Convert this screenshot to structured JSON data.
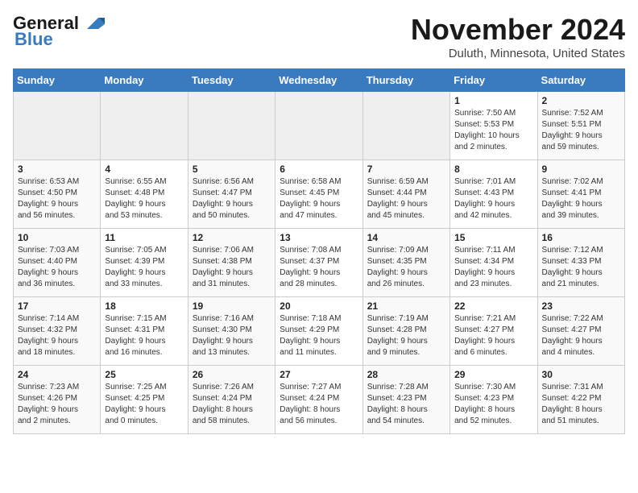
{
  "header": {
    "logo_general": "General",
    "logo_blue": "Blue",
    "month": "November 2024",
    "location": "Duluth, Minnesota, United States"
  },
  "weekdays": [
    "Sunday",
    "Monday",
    "Tuesday",
    "Wednesday",
    "Thursday",
    "Friday",
    "Saturday"
  ],
  "weeks": [
    [
      {
        "day": "",
        "info": ""
      },
      {
        "day": "",
        "info": ""
      },
      {
        "day": "",
        "info": ""
      },
      {
        "day": "",
        "info": ""
      },
      {
        "day": "",
        "info": ""
      },
      {
        "day": "1",
        "info": "Sunrise: 7:50 AM\nSunset: 5:53 PM\nDaylight: 10 hours\nand 2 minutes."
      },
      {
        "day": "2",
        "info": "Sunrise: 7:52 AM\nSunset: 5:51 PM\nDaylight: 9 hours\nand 59 minutes."
      }
    ],
    [
      {
        "day": "3",
        "info": "Sunrise: 6:53 AM\nSunset: 4:50 PM\nDaylight: 9 hours\nand 56 minutes."
      },
      {
        "day": "4",
        "info": "Sunrise: 6:55 AM\nSunset: 4:48 PM\nDaylight: 9 hours\nand 53 minutes."
      },
      {
        "day": "5",
        "info": "Sunrise: 6:56 AM\nSunset: 4:47 PM\nDaylight: 9 hours\nand 50 minutes."
      },
      {
        "day": "6",
        "info": "Sunrise: 6:58 AM\nSunset: 4:45 PM\nDaylight: 9 hours\nand 47 minutes."
      },
      {
        "day": "7",
        "info": "Sunrise: 6:59 AM\nSunset: 4:44 PM\nDaylight: 9 hours\nand 45 minutes."
      },
      {
        "day": "8",
        "info": "Sunrise: 7:01 AM\nSunset: 4:43 PM\nDaylight: 9 hours\nand 42 minutes."
      },
      {
        "day": "9",
        "info": "Sunrise: 7:02 AM\nSunset: 4:41 PM\nDaylight: 9 hours\nand 39 minutes."
      }
    ],
    [
      {
        "day": "10",
        "info": "Sunrise: 7:03 AM\nSunset: 4:40 PM\nDaylight: 9 hours\nand 36 minutes."
      },
      {
        "day": "11",
        "info": "Sunrise: 7:05 AM\nSunset: 4:39 PM\nDaylight: 9 hours\nand 33 minutes."
      },
      {
        "day": "12",
        "info": "Sunrise: 7:06 AM\nSunset: 4:38 PM\nDaylight: 9 hours\nand 31 minutes."
      },
      {
        "day": "13",
        "info": "Sunrise: 7:08 AM\nSunset: 4:37 PM\nDaylight: 9 hours\nand 28 minutes."
      },
      {
        "day": "14",
        "info": "Sunrise: 7:09 AM\nSunset: 4:35 PM\nDaylight: 9 hours\nand 26 minutes."
      },
      {
        "day": "15",
        "info": "Sunrise: 7:11 AM\nSunset: 4:34 PM\nDaylight: 9 hours\nand 23 minutes."
      },
      {
        "day": "16",
        "info": "Sunrise: 7:12 AM\nSunset: 4:33 PM\nDaylight: 9 hours\nand 21 minutes."
      }
    ],
    [
      {
        "day": "17",
        "info": "Sunrise: 7:14 AM\nSunset: 4:32 PM\nDaylight: 9 hours\nand 18 minutes."
      },
      {
        "day": "18",
        "info": "Sunrise: 7:15 AM\nSunset: 4:31 PM\nDaylight: 9 hours\nand 16 minutes."
      },
      {
        "day": "19",
        "info": "Sunrise: 7:16 AM\nSunset: 4:30 PM\nDaylight: 9 hours\nand 13 minutes."
      },
      {
        "day": "20",
        "info": "Sunrise: 7:18 AM\nSunset: 4:29 PM\nDaylight: 9 hours\nand 11 minutes."
      },
      {
        "day": "21",
        "info": "Sunrise: 7:19 AM\nSunset: 4:28 PM\nDaylight: 9 hours\nand 9 minutes."
      },
      {
        "day": "22",
        "info": "Sunrise: 7:21 AM\nSunset: 4:27 PM\nDaylight: 9 hours\nand 6 minutes."
      },
      {
        "day": "23",
        "info": "Sunrise: 7:22 AM\nSunset: 4:27 PM\nDaylight: 9 hours\nand 4 minutes."
      }
    ],
    [
      {
        "day": "24",
        "info": "Sunrise: 7:23 AM\nSunset: 4:26 PM\nDaylight: 9 hours\nand 2 minutes."
      },
      {
        "day": "25",
        "info": "Sunrise: 7:25 AM\nSunset: 4:25 PM\nDaylight: 9 hours\nand 0 minutes."
      },
      {
        "day": "26",
        "info": "Sunrise: 7:26 AM\nSunset: 4:24 PM\nDaylight: 8 hours\nand 58 minutes."
      },
      {
        "day": "27",
        "info": "Sunrise: 7:27 AM\nSunset: 4:24 PM\nDaylight: 8 hours\nand 56 minutes."
      },
      {
        "day": "28",
        "info": "Sunrise: 7:28 AM\nSunset: 4:23 PM\nDaylight: 8 hours\nand 54 minutes."
      },
      {
        "day": "29",
        "info": "Sunrise: 7:30 AM\nSunset: 4:23 PM\nDaylight: 8 hours\nand 52 minutes."
      },
      {
        "day": "30",
        "info": "Sunrise: 7:31 AM\nSunset: 4:22 PM\nDaylight: 8 hours\nand 51 minutes."
      }
    ]
  ]
}
